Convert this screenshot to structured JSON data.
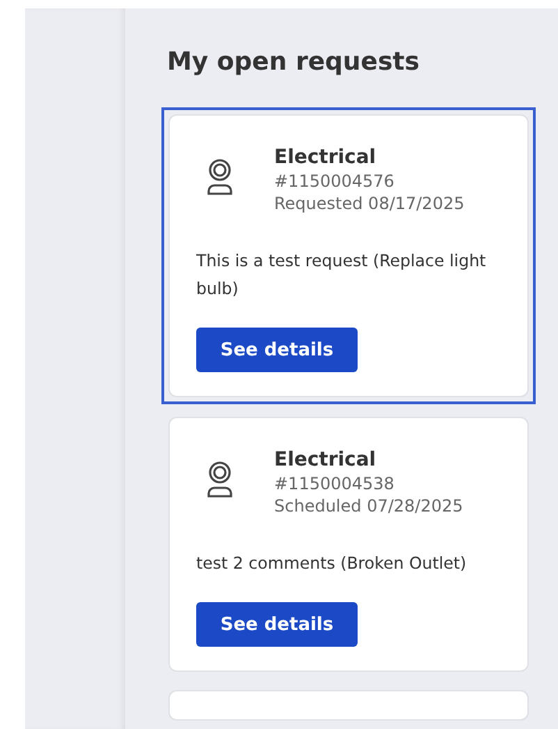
{
  "heading": "My open requests",
  "requests": [
    {
      "title": "Electrical",
      "number": "#1150004576",
      "date": "Requested 08/17/2025",
      "description": "This is a test request (Replace light bulb)",
      "button": "See details",
      "selected": true
    },
    {
      "title": "Electrical",
      "number": "#1150004538",
      "date": "Scheduled 07/28/2025",
      "description": "test 2 comments (Broken Outlet)",
      "button": "See details",
      "selected": false
    }
  ]
}
